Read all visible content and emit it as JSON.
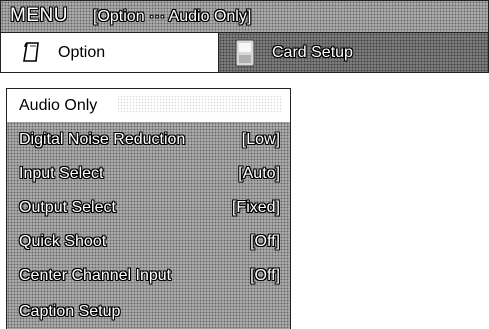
{
  "title_bar": {
    "menu_label": "MENU",
    "breadcrumb": "[Option ··· Audio Only]"
  },
  "tabs": [
    {
      "label": "Option",
      "icon": "option-page-icon",
      "active": true
    },
    {
      "label": "Card Setup",
      "icon": "card-icon",
      "active": false
    }
  ],
  "menu_items": [
    {
      "label": "Audio Only",
      "value": "",
      "selected": true
    },
    {
      "label": "Digital Noise Reduction",
      "value": "[Low]"
    },
    {
      "label": "Input Select",
      "value": "[Auto]"
    },
    {
      "label": "Output Select",
      "value": "[Fixed]"
    },
    {
      "label": "Quick Shoot",
      "value": "[Off]"
    },
    {
      "label": "Center Channel Input",
      "value": "[Off]"
    },
    {
      "label": "Caption Setup",
      "value": ""
    }
  ],
  "colors": {
    "menu_background": "#9a9a9a",
    "selected_background": "#ffffff",
    "text": "#ffffff",
    "text_outline": "#000000"
  }
}
